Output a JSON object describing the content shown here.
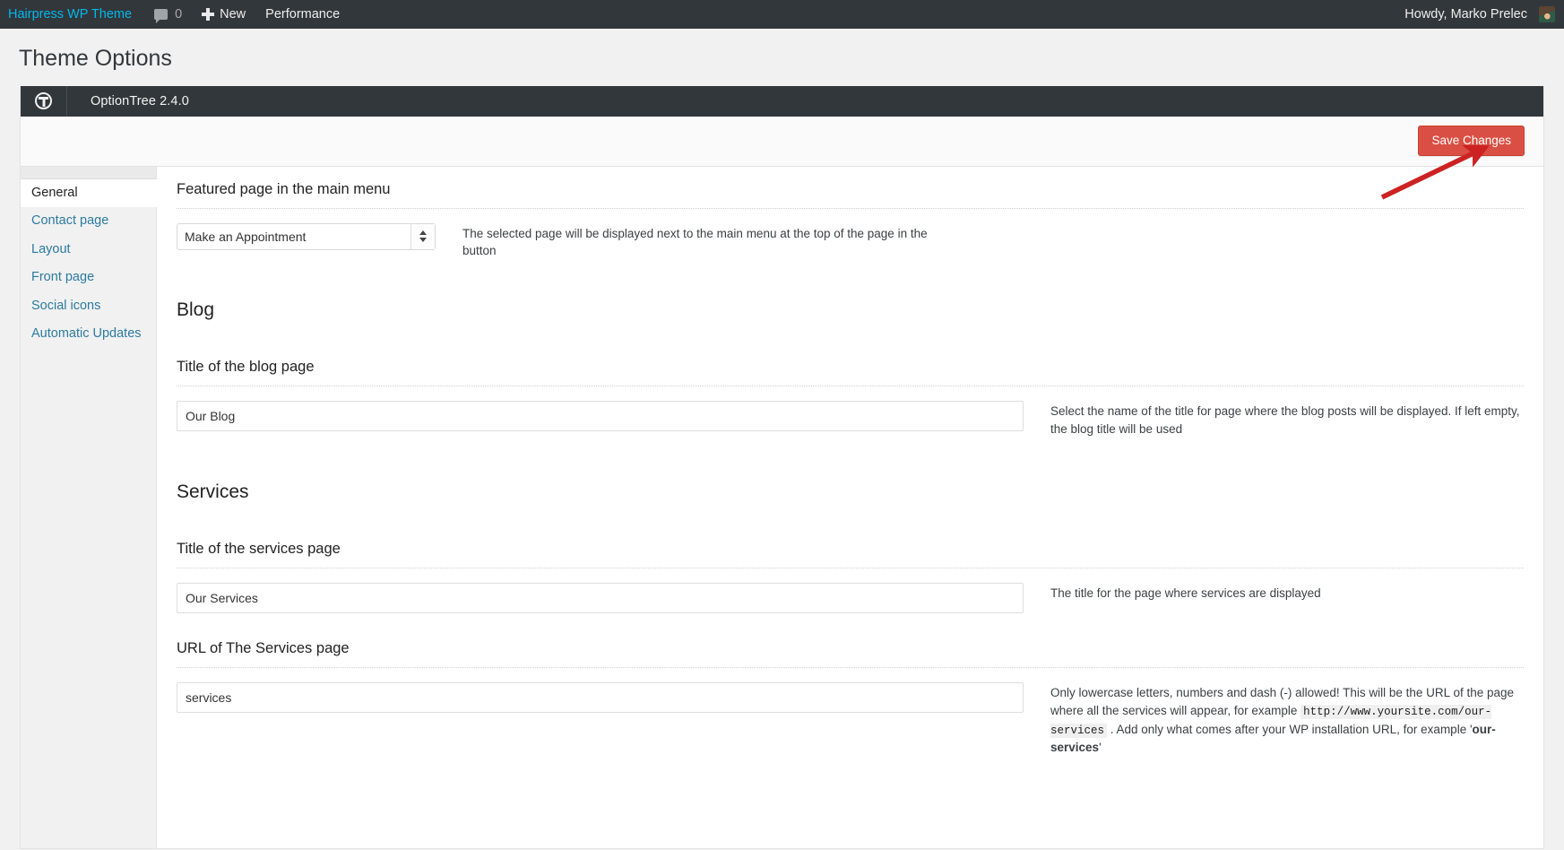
{
  "adminbar": {
    "site_name": "Hairpress WP Theme",
    "comments_icon": "comment-bubble-icon",
    "comments_count": "0",
    "new_icon": "plus-icon",
    "new_label": "New",
    "performance_label": "Performance",
    "howdy": "Howdy, Marko Prelec",
    "avatar_icon": "user-avatar"
  },
  "page": {
    "title": "Theme Options"
  },
  "optiontree": {
    "logo_icon": "optiontree-logo-icon",
    "version_label": "OptionTree 2.4.0",
    "save_label": "Save Changes"
  },
  "tabs": [
    {
      "label": "General",
      "active": true
    },
    {
      "label": "Contact page",
      "active": false
    },
    {
      "label": "Layout",
      "active": false
    },
    {
      "label": "Front page",
      "active": false
    },
    {
      "label": "Social icons",
      "active": false
    },
    {
      "label": "Automatic Updates",
      "active": false
    }
  ],
  "settings": {
    "featured_page": {
      "title": "Featured page in the main menu",
      "select_value": "Make an Appointment",
      "options": [
        "Make an Appointment"
      ],
      "description": "The selected page will be displayed next to the main menu at the top of the page in the button"
    },
    "blog_section": "Blog",
    "blog_title": {
      "title": "Title of the blog page",
      "value": "Our Blog",
      "placeholder": "",
      "description": "Select the name of the title for page where the blog posts will be displayed. If left empty, the blog title will be used"
    },
    "services_section": "Services",
    "services_title": {
      "title": "Title of the services page",
      "value": "Our Services",
      "placeholder": "",
      "description": "The title for the page where services are displayed"
    },
    "services_url": {
      "title": "URL of The Services page",
      "value": "services",
      "placeholder": "",
      "desc_part1": "Only lowercase letters, numbers and dash (-) allowed! This will be the URL of the page where all the services will appear, for example ",
      "desc_code": "http://www.yoursite.com/our-services",
      "desc_part2": " . Add only what comes after your WP installation URL, for example '",
      "desc_strong": "our-services",
      "desc_part3": "'"
    }
  },
  "colors": {
    "admin_bar": "#32373c",
    "save_button": "#d94f43",
    "link_blue": "#2c7ba0",
    "annotation_red": "#cc2222"
  }
}
